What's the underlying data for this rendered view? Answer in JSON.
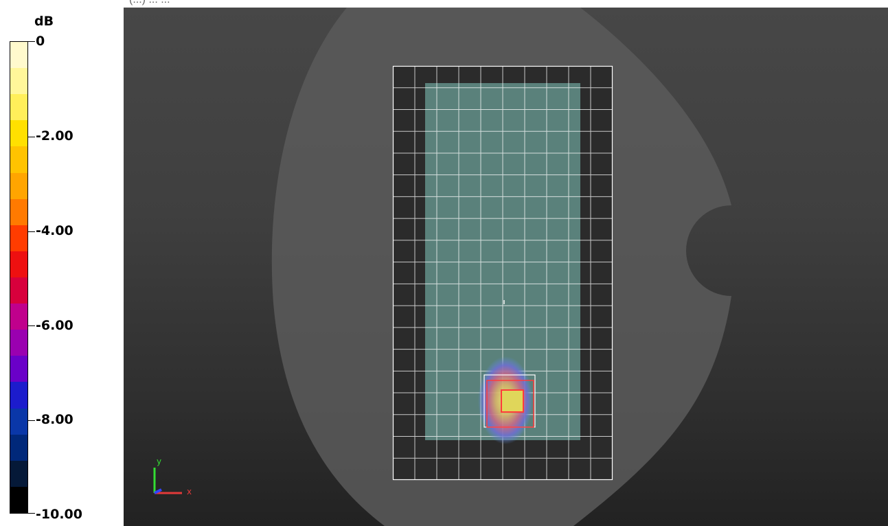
{
  "legend": {
    "unit": "dB",
    "labels": [
      "0",
      "-2.00",
      "-4.00",
      "-6.00",
      "-8.00",
      "-10.00"
    ],
    "colors": [
      "#fffacd",
      "#fff79a",
      "#ffef5a",
      "#ffe000",
      "#ffc300",
      "#ffa500",
      "#ff7a00",
      "#ff3c00",
      "#ee1010",
      "#d8003c",
      "#c0008c",
      "#9a00b0",
      "#6a00c8",
      "#1c1ccc",
      "#0a37a8",
      "#00287a",
      "#051938",
      "#000000"
    ]
  },
  "viewport": {
    "background_top": "#474747",
    "background_bottom": "#222222",
    "phantom_color": "#5b5b5b",
    "device_color": "#2b2b2b",
    "grid_color": "#ffffff",
    "display_color": "#5a817b",
    "hotspot_box_color": "#ff3b3b",
    "axis": {
      "x_label": "x",
      "y_label": "y",
      "x_color": "#e23a3a",
      "y_color": "#33dd33",
      "z_color": "#3344ff"
    }
  },
  "top_caption": "(...) ... ..."
}
